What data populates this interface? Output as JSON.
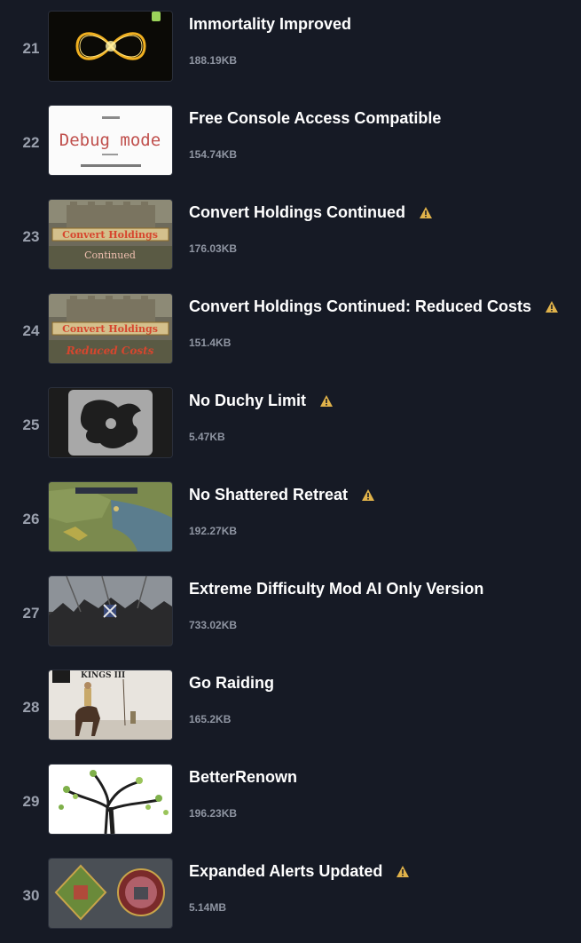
{
  "mods": [
    {
      "index": "21",
      "title": "Immortality Improved",
      "size": "188.19KB",
      "warning": false,
      "thumb_icon": "infinity-thumbnail"
    },
    {
      "index": "22",
      "title": "Free Console Access Compatible",
      "size": "154.74KB",
      "warning": false,
      "thumb_icon": "debug-mode-thumbnail",
      "thumb_text": "Debug mode"
    },
    {
      "index": "23",
      "title": "Convert Holdings Continued",
      "size": "176.03KB",
      "warning": true,
      "thumb_icon": "castle-thumbnail",
      "thumb_text": "Convert Holdings",
      "thumb_subtext": "Continued"
    },
    {
      "index": "24",
      "title": "Convert Holdings Continued: Reduced Costs",
      "size": "151.4KB",
      "warning": true,
      "thumb_icon": "castle-thumbnail",
      "thumb_text": "Convert Holdings",
      "thumb_subtext": "Reduced Costs"
    },
    {
      "index": "25",
      "title": "No Duchy Limit",
      "size": "5.47KB",
      "warning": true,
      "thumb_icon": "heraldic-beast-thumbnail"
    },
    {
      "index": "26",
      "title": "No Shattered Retreat",
      "size": "192.27KB",
      "warning": true,
      "thumb_icon": "map-thumbnail"
    },
    {
      "index": "27",
      "title": "Extreme Difficulty Mod AI Only Version",
      "size": "733.02KB",
      "warning": false,
      "thumb_icon": "army-thumbnail"
    },
    {
      "index": "28",
      "title": "Go Raiding",
      "size": "165.2KB",
      "warning": false,
      "thumb_icon": "rider-thumbnail",
      "thumb_text": "KINGS III"
    },
    {
      "index": "29",
      "title": "BetterRenown",
      "size": "196.23KB",
      "warning": false,
      "thumb_icon": "tree-thumbnail"
    },
    {
      "index": "30",
      "title": "Expanded Alerts Updated",
      "size": "5.14MB",
      "warning": true,
      "thumb_icon": "alert-icons-thumbnail"
    }
  ],
  "colors": {
    "background": "#161a25",
    "title": "#ffffff",
    "index": "#9aa0ad",
    "size": "#8f95a2",
    "warning": "#e0b24a"
  }
}
